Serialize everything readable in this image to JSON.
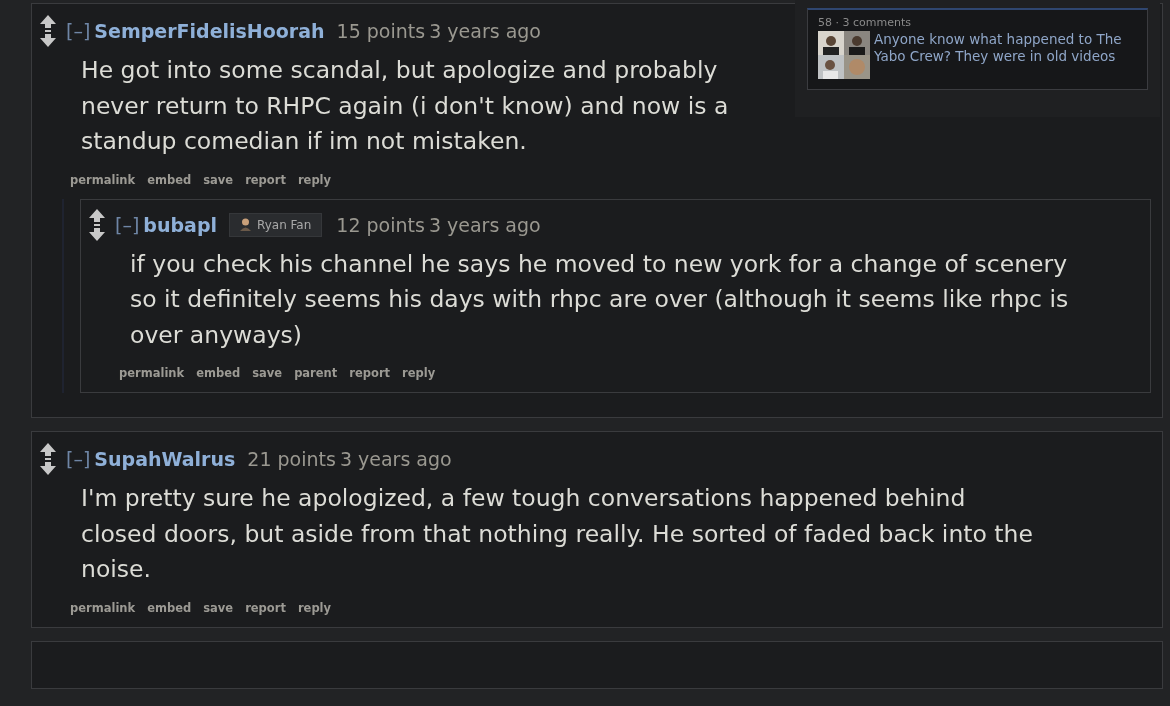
{
  "comments": [
    {
      "collapse": "[–]",
      "author": "SemperFidelisHoorah",
      "score": "15 points",
      "time": "3 years ago",
      "body": "He got into some scandal, but apologize and probably never return to RHPC again (i don't know) and now is a standup comedian if im not mistaken.",
      "actions": [
        "permalink",
        "embed",
        "save",
        "report",
        "reply"
      ],
      "children": [
        {
          "collapse": "[–]",
          "author": "bubapl",
          "flair": "Ryan Fan",
          "score": "12 points",
          "time": "3 years ago",
          "body": "if you check his channel he says he moved to new york for a change of scenery so it definitely seems his days with rhpc are over (although it seems like rhpc is over anyways)",
          "actions": [
            "permalink",
            "embed",
            "save",
            "parent",
            "report",
            "reply"
          ]
        }
      ]
    },
    {
      "collapse": "[–]",
      "author": "SupahWalrus",
      "score": "21 points",
      "time": "3 years ago",
      "body": "I'm pretty sure he apologized, a few tough conversations happened behind closed doors, but aside from that nothing really. He sorted of faded back into the noise.",
      "actions": [
        "permalink",
        "embed",
        "save",
        "report",
        "reply"
      ]
    }
  ],
  "sidebar": {
    "meta": "58 · 3 comments",
    "title": "Anyone know what happened to The Yabo Crew? They were in old videos"
  }
}
